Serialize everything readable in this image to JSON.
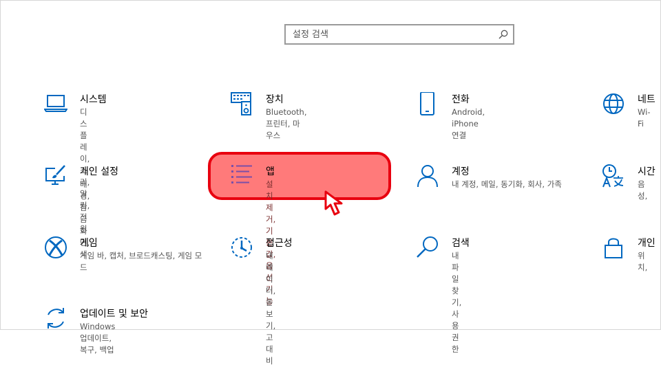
{
  "search": {
    "placeholder": "설정 검색"
  },
  "tiles": [
    {
      "title": "시스템",
      "desc": "디스플레이, 소리, 알림, 전원",
      "icon": "laptop-icon"
    },
    {
      "title": "장치",
      "desc": "Bluetooth, 프린터, 마우스",
      "icon": "keyboard-speaker-icon"
    },
    {
      "title": "전화",
      "desc": "Android, iPhone 연결",
      "icon": "phone-icon"
    },
    {
      "title": "네트",
      "desc": "Wi-Fi",
      "icon": "globe-icon"
    },
    {
      "title": "개인 설정",
      "desc": "배경, 잠금 화면, 색",
      "icon": "personalization-icon"
    },
    {
      "title": "앱",
      "desc": "설치 제거, 기본값, 옵션 기능",
      "icon": "apps-list-icon"
    },
    {
      "title": "계정",
      "desc": "내 계정, 메일, 동기화, 회사, 가족",
      "icon": "person-icon"
    },
    {
      "title": "시간",
      "desc": "음성,",
      "icon": "time-language-icon"
    },
    {
      "title": "게임",
      "desc": "게임 바, 캡처, 브로드캐스팅, 게임 모드",
      "icon": "xbox-icon"
    },
    {
      "title": "접근성",
      "desc": "내레이터, 돋보기, 고대비",
      "icon": "ease-of-access-icon"
    },
    {
      "title": "검색",
      "desc": "내 파일 찾기, 사용 권한",
      "icon": "magnifier-icon"
    },
    {
      "title": "개인",
      "desc": "위치,",
      "icon": "lock-icon"
    },
    {
      "title": "업데이트 및 보안",
      "desc": "Windows 업데이트, 복구, 백업",
      "icon": "update-icon"
    }
  ],
  "highlight_color": "#ff7a7a",
  "accent_color": "#0067c0"
}
